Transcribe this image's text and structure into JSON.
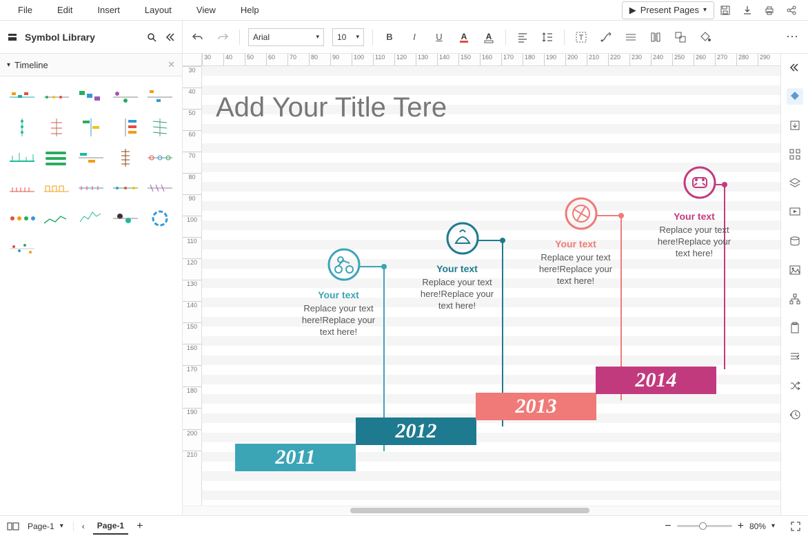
{
  "menubar": {
    "items": [
      "File",
      "Edit",
      "Insert",
      "Layout",
      "View",
      "Help"
    ],
    "present": "Present Pages"
  },
  "library": {
    "title": "Symbol Library",
    "section": "Timeline"
  },
  "toolbar": {
    "font": "Arial",
    "fontsize": "10"
  },
  "ruler": {
    "h": [
      "30",
      "40",
      "50",
      "60",
      "70",
      "80",
      "90",
      "100",
      "110",
      "120",
      "130",
      "140",
      "150",
      "160",
      "170",
      "180",
      "190",
      "200",
      "210",
      "220",
      "230",
      "240",
      "250",
      "260",
      "270",
      "280",
      "290"
    ],
    "v": [
      "30",
      "40",
      "50",
      "60",
      "70",
      "80",
      "90",
      "100",
      "110",
      "120",
      "130",
      "140",
      "150",
      "160",
      "170",
      "180",
      "190",
      "200",
      "210"
    ]
  },
  "canvas": {
    "title": "Add Your Title Tere",
    "steps": [
      {
        "year": "2011",
        "heading": "Your text",
        "desc": "Replace your text here!Replace your text here!",
        "color": "c1"
      },
      {
        "year": "2012",
        "heading": "Your text",
        "desc": "Replace your text here!Replace your text here!",
        "color": "c2"
      },
      {
        "year": "2013",
        "heading": "Your text",
        "desc": "Replace your text here!Replace your text here!",
        "color": "c3"
      },
      {
        "year": "2014",
        "heading": "Your text",
        "desc": "Replace your text here!Replace your text here!",
        "color": "c4"
      }
    ]
  },
  "status": {
    "page_select": "Page-1",
    "page_tab": "Page-1",
    "zoom": "80%"
  }
}
